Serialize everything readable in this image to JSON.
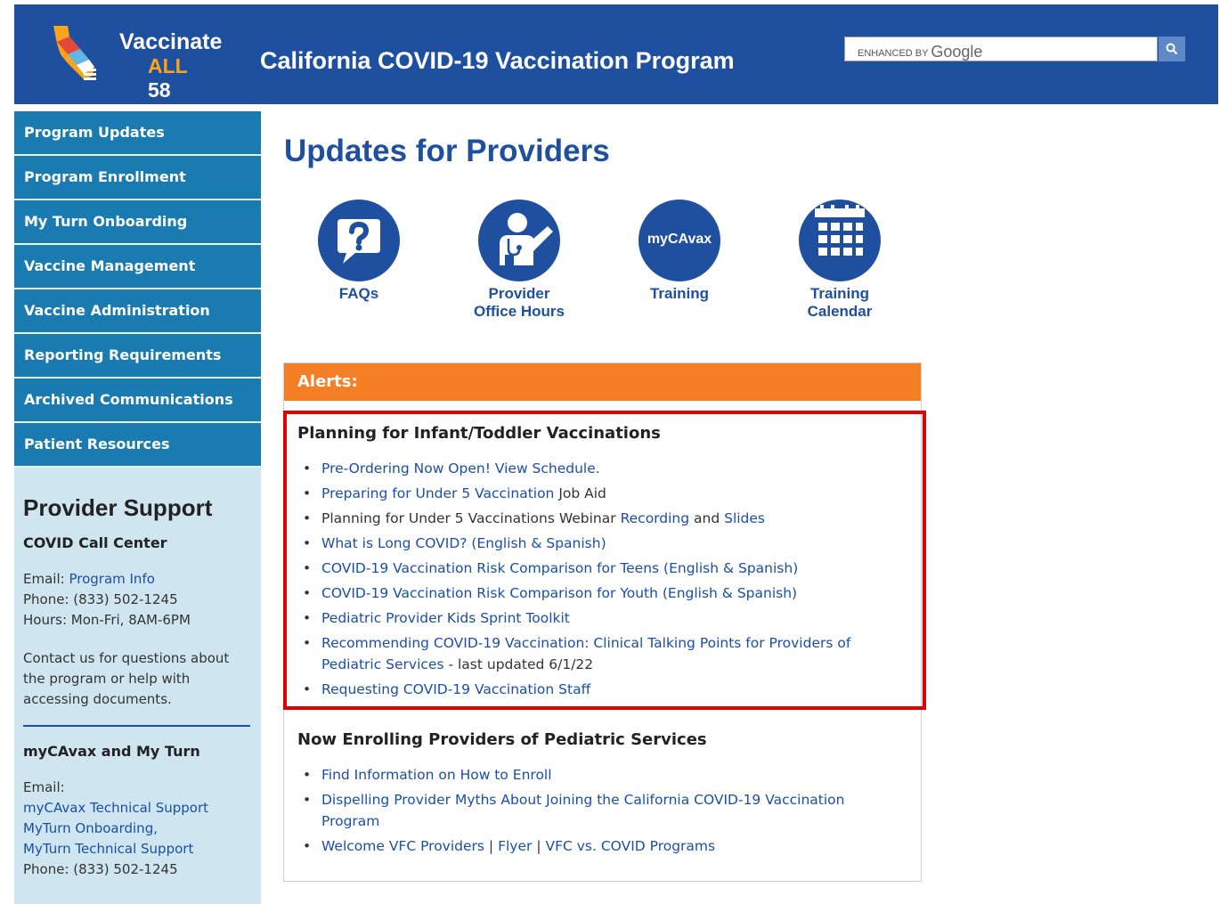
{
  "header": {
    "logo_line1": "Vaccinate",
    "logo_line2a": "ALL",
    "logo_line2b": "58",
    "title": "California COVID-19 Vaccination Program",
    "search_brand": "ENHANCED BY",
    "search_brand_google": "Google"
  },
  "nav": [
    {
      "label": "Program Updates"
    },
    {
      "label": "Program Enrollment"
    },
    {
      "label": "My Turn Onboarding"
    },
    {
      "label": "Vaccine Management"
    },
    {
      "label": "Vaccine Administration"
    },
    {
      "label": "Reporting Requirements"
    },
    {
      "label": "Archived Communications"
    },
    {
      "label": "Patient Resources"
    }
  ],
  "support": {
    "title": "Provider Support",
    "call_center_heading": "COVID Call Center",
    "email_label": "Email:",
    "email_link": "Program Info",
    "phone": "Phone: (833) 502-1245",
    "hours": "Hours: Mon-Fri, 8AM-6PM",
    "contact_text": "Contact us for questions about the program or help with accessing documents.",
    "mycavax_heading": "myCAvax and My Turn",
    "email2_label": "Email:",
    "email2_link1": "myCAvax Technical Support",
    "email2_link2": "MyTurn Onboarding,",
    "email2_link3": "MyTurn Technical Support",
    "phone2": "Phone: (833) 502-1245"
  },
  "main": {
    "title": "Updates for Providers",
    "quick_links": [
      {
        "label_1": "FAQs",
        "label_2": ""
      },
      {
        "label_1": "Provider",
        "label_2": "Office Hours"
      },
      {
        "label_1": "Training",
        "label_2": "",
        "icon_text": "myCAvax"
      },
      {
        "label_1": "Training",
        "label_2": "Calendar"
      }
    ]
  },
  "alerts": {
    "bar_label": "Alerts:",
    "section1_title": "Planning for Infant/Toddler Vaccinations",
    "section1_items": {
      "i1": "Pre-Ordering Now Open! View Schedule.",
      "i2_link": "Preparing for Under 5 Vaccination",
      "i2_text": " Job Aid",
      "i3_text": "Planning for Under 5 Vaccinations Webinar ",
      "i3_link1": "Recording",
      "i3_and": " and ",
      "i3_link2": "Slides",
      "i4": "What is Long COVID? (English & Spanish)",
      "i5": "COVID-19 Vaccination Risk Comparison for Teens (English & Spanish)",
      "i6": "COVID-19 Vaccination Risk Comparison for Youth (English & Spanish)",
      "i7": "Pediatric Provider Kids Sprint Toolkit",
      "i8_link": "Recommending COVID-19 Vaccination: Clinical Talking Points for Providers of Pediatric Services",
      "i8_text": " - last updated 6/1/22",
      "i9": "Requesting COVID-19 Vaccination Staff"
    },
    "section2_title": "Now Enrolling Providers of Pediatric Services",
    "section2_items": {
      "i1": "Find Information on How to Enroll",
      "i2": "Dispelling Provider Myths About Joining the California COVID-19 Vaccination Program",
      "i3_link1": "Welcome VFC Providers",
      "i3_sep1": " | ",
      "i3_link2": "Flyer",
      "i3_sep2": " | ",
      "i3_link3": "VFC vs. COVID Programs"
    }
  },
  "colors": {
    "header_blue": "#1f4f9f",
    "nav_blue": "#1a7bb0",
    "sidebar_bg": "#cfe6f1",
    "alert_orange": "#f47f24",
    "highlight_red": "#e00000",
    "link": "#1a4fa8"
  }
}
